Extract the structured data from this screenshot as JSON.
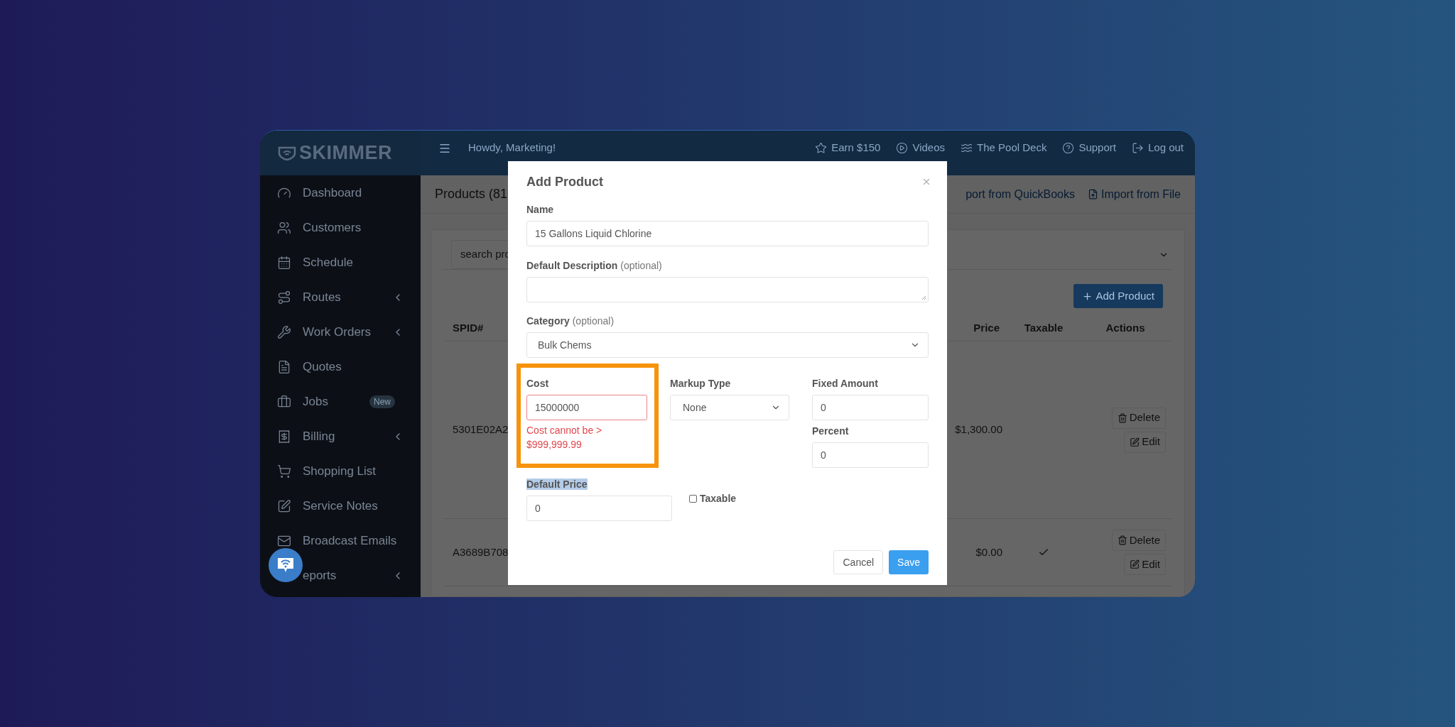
{
  "brand": {
    "name": "SKIMMER"
  },
  "top_bar": {
    "greeting": "Howdy, Marketing!",
    "links": [
      {
        "label": "Earn $150"
      },
      {
        "label": "Videos"
      },
      {
        "label": "The Pool Deck"
      },
      {
        "label": "Support"
      },
      {
        "label": "Log out"
      }
    ]
  },
  "sidebar": {
    "items": [
      {
        "label": "Dashboard",
        "has_submenu": false
      },
      {
        "label": "Customers",
        "has_submenu": false
      },
      {
        "label": "Schedule",
        "has_submenu": false
      },
      {
        "label": "Routes",
        "has_submenu": true
      },
      {
        "label": "Work Orders",
        "has_submenu": true
      },
      {
        "label": "Quotes",
        "has_submenu": false
      },
      {
        "label": "Jobs",
        "has_submenu": false,
        "badge": "New"
      },
      {
        "label": "Billing",
        "has_submenu": true
      },
      {
        "label": "Shopping List",
        "has_submenu": false
      },
      {
        "label": "Service Notes",
        "has_submenu": false
      },
      {
        "label": "Broadcast Emails",
        "has_submenu": false
      },
      {
        "label": "eports",
        "has_submenu": true
      }
    ]
  },
  "page": {
    "title": "Products (81",
    "actions": [
      {
        "label": "port from QuickBooks",
        "kind": "plain"
      },
      {
        "label": "Import from File",
        "kind": "file"
      }
    ],
    "search": {
      "placeholder": "search pro"
    },
    "add_button": "Add Product",
    "table": {
      "columns": [
        "SPID#",
        "Price",
        "Taxable",
        "Actions"
      ],
      "rows": [
        {
          "spid": "5301E02A2",
          "price": "$1,300.00",
          "taxable": false,
          "actions": [
            "Delete",
            "Edit"
          ]
        },
        {
          "spid": "A3689B708",
          "price": "$0.00",
          "taxable": true,
          "actions": [
            "Delete",
            "Edit"
          ]
        }
      ]
    }
  },
  "modal": {
    "title": "Add Product",
    "name": {
      "label": "Name",
      "value": "15 Gallons Liquid Chlorine"
    },
    "description": {
      "label": "Default Description",
      "hint": "(optional)"
    },
    "category": {
      "label": "Category",
      "hint": "(optional)",
      "value": "Bulk Chems"
    },
    "cost": {
      "label": "Cost",
      "value": "15000000",
      "invalid": true,
      "error": "Cost cannot be > $999,999.99",
      "highlighted": true
    },
    "markup_type": {
      "label": "Markup Type",
      "value": "None"
    },
    "fixed_amount": {
      "label": "Fixed Amount",
      "value": "0"
    },
    "percent": {
      "label": "Percent",
      "value": "0"
    },
    "default_price": {
      "label": "Default Price",
      "value": "0",
      "label_selected": true
    },
    "taxable": {
      "label": "Taxable",
      "checked": false
    },
    "buttons": [
      {
        "label": "Cancel",
        "kind": "secondary"
      },
      {
        "label": "Save",
        "kind": "primary"
      }
    ]
  }
}
